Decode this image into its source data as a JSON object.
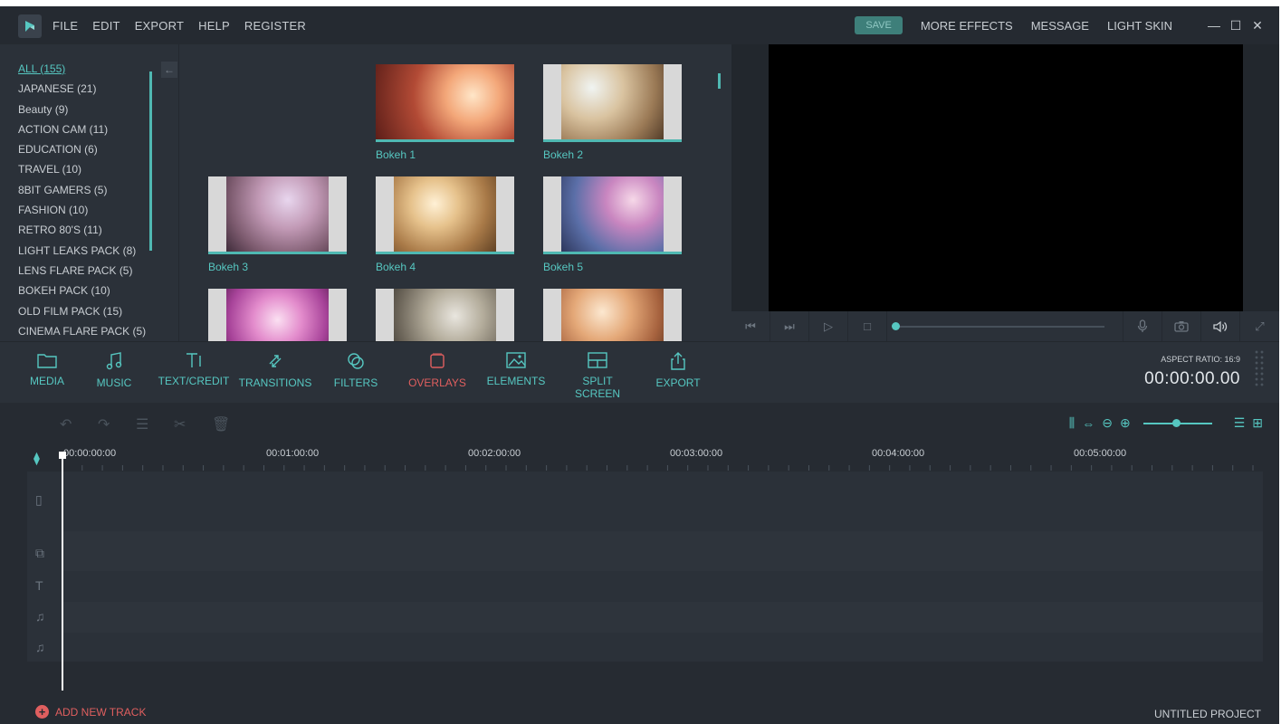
{
  "titlebar": {
    "menu": [
      "FILE",
      "EDIT",
      "EXPORT",
      "HELP",
      "REGISTER"
    ],
    "save_label": "SAVE",
    "right_menu": [
      "MORE EFFECTS",
      "MESSAGE",
      "LIGHT SKIN"
    ],
    "window_controls": {
      "minimize": "—",
      "maximize": "☐",
      "close": "✕"
    }
  },
  "categories": [
    "ALL (155)",
    "JAPANESE (21)",
    "Beauty (9)",
    "ACTION CAM (11)",
    "EDUCATION (6)",
    "TRAVEL (10)",
    "8BIT GAMERS (5)",
    "FASHION (10)",
    "RETRO 80'S (11)",
    "LIGHT LEAKS PACK (8)",
    "LENS FLARE PACK (5)",
    "BOKEH PACK (10)",
    "OLD FILM PACK (15)",
    "CINEMA FLARE PACK (5)"
  ],
  "active_category": "ALL (155)",
  "media": [
    "Bokeh 1",
    "Bokeh 2",
    "Bokeh 3",
    "Bokeh 4",
    "Bokeh 5",
    "",
    "",
    ""
  ],
  "toolbar": {
    "tools": [
      "MEDIA",
      "MUSIC",
      "TEXT/CREDIT",
      "TRANSITIONS",
      "FILTERS",
      "OVERLAYS",
      "ELEMENTS",
      "SPLIT SCREEN",
      "EXPORT"
    ],
    "active": "OVERLAYS",
    "aspect_ratio": "ASPECT RATIO: 16:9",
    "timecode": "00:00:00.00"
  },
  "timeline": {
    "ruler": [
      "00:00:00:00",
      "00:01:00:00",
      "00:02:00:00",
      "00:03:00:00",
      "00:04:00:00",
      "00:05:00:00"
    ],
    "add_track": "ADD NEW TRACK",
    "project_name": "UNTITLED PROJECT",
    "zoom_level": 0.45
  },
  "colors": {
    "accent": "#56c7c1",
    "active": "#e05f5f",
    "bg": "#2b3139"
  }
}
